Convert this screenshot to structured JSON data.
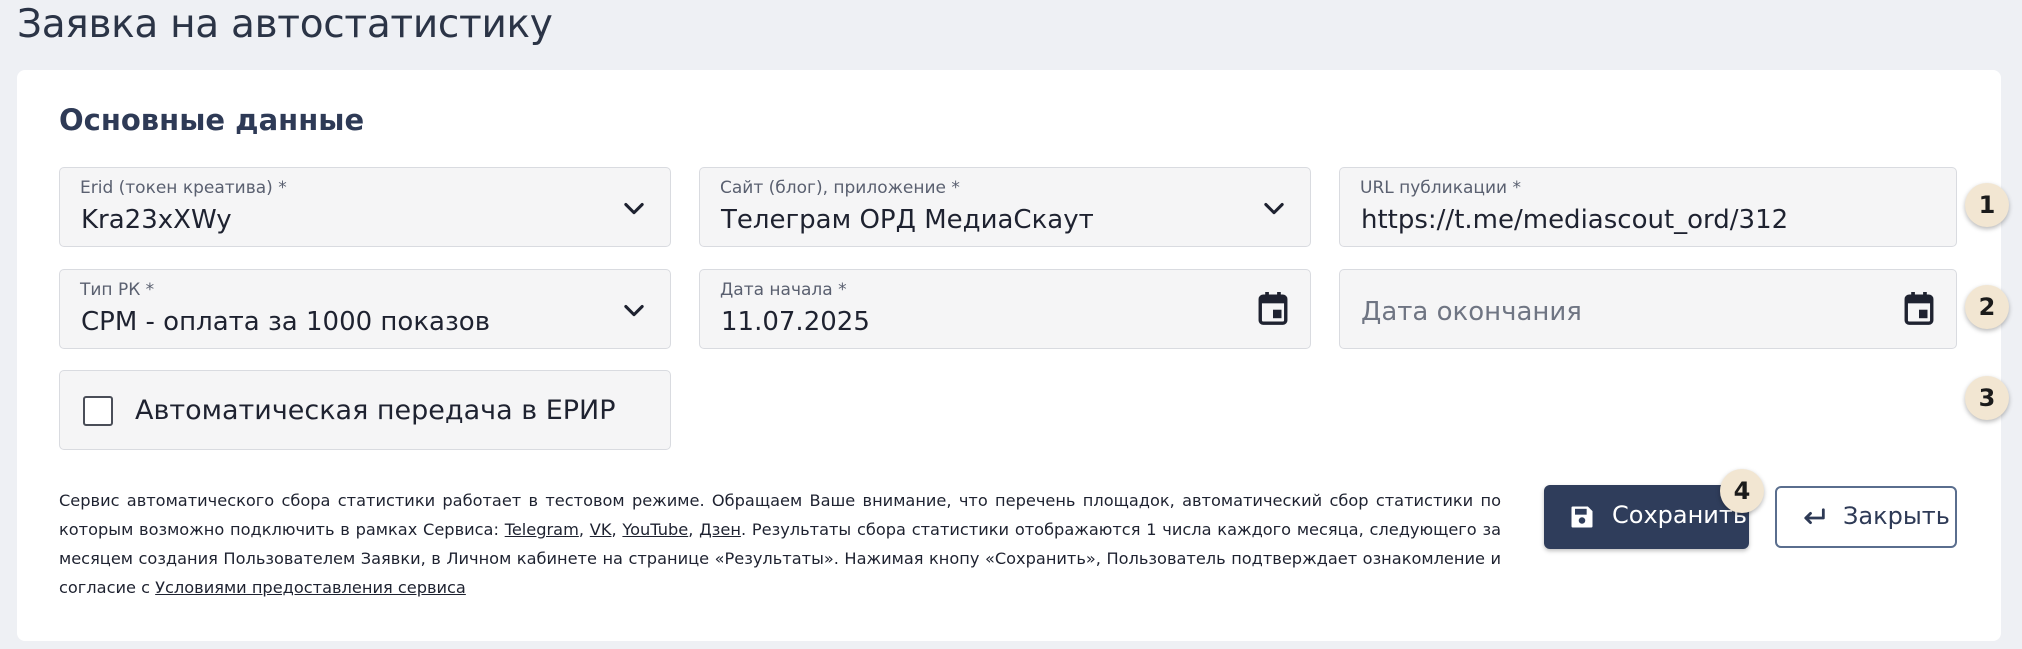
{
  "page": {
    "title": "Заявка на автостатистику"
  },
  "section": {
    "title": "Основные данные"
  },
  "fields": {
    "erid": {
      "label": "Erid (токен креатива) *",
      "value": "Kra23xXWy",
      "icon": "chevron-down-icon"
    },
    "site": {
      "label": "Сайт (блог), приложение *",
      "value": "Телеграм ОРД МедиаСкаут",
      "icon": "chevron-down-icon"
    },
    "url": {
      "label": "URL публикации *",
      "value": "https://t.me/mediascout_ord/312"
    },
    "rk_type": {
      "label": "Тип РК *",
      "value": "CPM - оплата за 1000 показов",
      "icon": "chevron-down-icon"
    },
    "start_date": {
      "label": "Дата начала *",
      "value": "11.07.2025",
      "icon": "calendar-icon"
    },
    "end_date": {
      "placeholder": "Дата окончания",
      "icon": "calendar-icon"
    }
  },
  "checkbox": {
    "label": "Автоматическая передача в ЕРИР",
    "checked": false
  },
  "notice": {
    "text1": "Сервис автоматического сбора статистики работает в тестовом режиме. Обращаем Ваше внимание, что перечень площадок, автоматический сбор статистики по которым возможно подключить в рамках Сервиса: ",
    "link_telegram": "Telegram",
    "sep1": ", ",
    "link_vk": "VK",
    "sep2": ", ",
    "link_youtube": "YouTube",
    "sep3": ", ",
    "link_dzen": "Дзен",
    "text2": ". Результаты сбора статистики отображаются 1 числа каждого месяца, следующего за месяцем создания Пользователем Заявки, в Личном кабинете на странице «Результаты». Нажимая кнопу «Сохранить», Пользователь подтверждает ознакомление и согласие с ",
    "link_terms": "Условиями предоставления сервиса"
  },
  "buttons": {
    "save": {
      "label": "Сохранить",
      "icon": "save-icon"
    },
    "close": {
      "label": "Закрыть",
      "icon": "return-arrow-icon"
    }
  },
  "badges": [
    "1",
    "2",
    "3",
    "4"
  ],
  "colors": {
    "primary_button": "#2f3d5b",
    "badge_bg": "#f2e6d2",
    "page_bg": "#eef0f4",
    "field_bg": "#f5f5f6"
  }
}
